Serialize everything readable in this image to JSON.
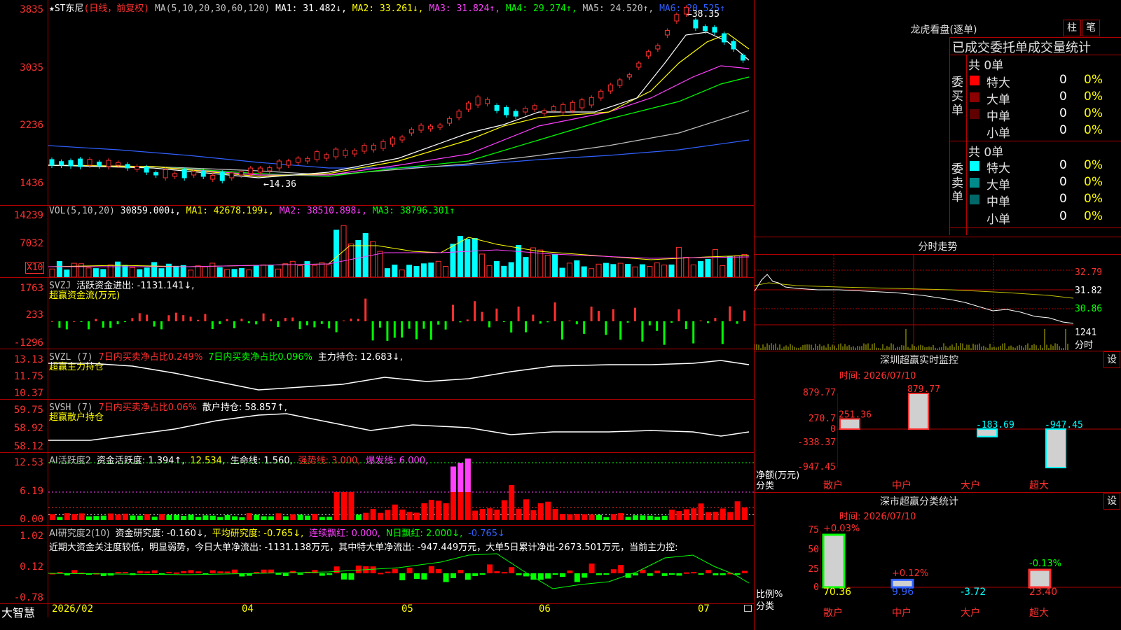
{
  "stock": {
    "name": "★ST东尼",
    "period": "(日线，前复权)"
  },
  "ma_header": {
    "label": "MA(5,10,20,30,60,120)",
    "ma1": "MA1: 31.482↓,",
    "ma2": "MA2: 33.261↓,",
    "ma3": "MA3: 31.824↑,",
    "ma4": "MA4: 29.274↑,",
    "ma5": "MA5: 24.520↑,",
    "ma6": "MA6: 20.525↑",
    "colors": {
      "ma1": "#ffffff",
      "ma2": "#ffff00",
      "ma3": "#ff40ff",
      "ma4": "#00ff00",
      "ma5": "#c0c0c0",
      "ma6": "#3060ff"
    }
  },
  "price_axis": [
    "3835",
    "3035",
    "2236",
    "1436"
  ],
  "price_marks": {
    "high": "←38.35",
    "low": "←14.36"
  },
  "vol": {
    "label": "VOL(5,10,20)",
    "value": "30859.000↓,",
    "ma1": "MA1: 42678.199↓,",
    "ma2": "MA2: 38510.898↓,",
    "ma3": "MA3: 38796.301↑",
    "axis": [
      "14239",
      "7032"
    ],
    "unit": "X10"
  },
  "svzj": {
    "label": "SVZJ",
    "text": "活跃资金进出: -1131.141↓,",
    "sub": "超赢资金流(万元)",
    "axis": [
      "1763",
      "233",
      "-1296"
    ]
  },
  "svzl": {
    "label": "SVZL (7)",
    "t1": "7日内买卖净占比0.249%",
    "t2": "7日内买卖净占比0.096%",
    "t3": "主力持仓: 12.683↓,",
    "sub": "超赢主力持仓",
    "axis": [
      "13.13",
      "11.75",
      "10.37"
    ]
  },
  "svsh": {
    "label": "SVSH (7)",
    "t1": "7日内买卖净占比0.06%",
    "t2": "散户持仓: 58.857↑,",
    "sub": "超赢散户持仓",
    "axis": [
      "59.75",
      "58.92",
      "58.12"
    ]
  },
  "ai1": {
    "label": "AI活跃度2",
    "t1": "资金活跃度: 1.394↑,",
    "t2": "12.534,",
    "t3": "生命线: 1.560,",
    "t4": "强势线: 3.000,",
    "t5": "爆发线: 6.000,",
    "axis": [
      "12.53",
      "6.19",
      "0.00"
    ]
  },
  "ai2": {
    "label": "AI研究度2(10)",
    "t1": "资金研究度: -0.160↓,",
    "t2": "平均研究度: -0.765↓,",
    "t3": "连续飘红: 0.000,",
    "t4": "N日飘红: 2.000↓,",
    "t5": "-0.765↓",
    "desc": "近期大资金关注度较低，明显弱势，今日大单净流出: -1131.138万元，其中特大单净流出: -947.449万元，大单5日累计净出-2673.501万元，当前主力控:",
    "axis": [
      "1.02",
      "0.12",
      "-0.78"
    ]
  },
  "x_axis": [
    "2026/02",
    "04",
    "05",
    "06",
    "07"
  ],
  "app_name": "大智慧",
  "longhu": {
    "title": "龙虎看盘(逐单)",
    "btn1": "柱",
    "btn2": "笔",
    "subtitle": "已成交委托单成交量统计",
    "buy_label": "委买单",
    "sell_label": "委卖单",
    "buy_total": "共 0单",
    "sell_total": "共 0单",
    "buy_rows": [
      {
        "name": "特大",
        "v1": "0",
        "v2": "0%",
        "color": "#ff0000"
      },
      {
        "name": "大单",
        "v1": "0",
        "v2": "0%",
        "color": "#8b0000"
      },
      {
        "name": "中单",
        "v1": "0",
        "v2": "0%",
        "color": "#600000"
      },
      {
        "name": "小单",
        "v1": "0",
        "v2": "0%",
        "color": ""
      }
    ],
    "sell_rows": [
      {
        "name": "特大",
        "v1": "0",
        "v2": "0%",
        "color": "#00ffff"
      },
      {
        "name": "大单",
        "v1": "0",
        "v2": "0%",
        "color": "#008b8b"
      },
      {
        "name": "中单",
        "v1": "0",
        "v2": "0%",
        "color": "#006868"
      },
      {
        "name": "小单",
        "v1": "0",
        "v2": "0%",
        "color": ""
      }
    ]
  },
  "intraday": {
    "title": "分时走势",
    "axis": [
      "32.79",
      "31.82",
      "30.86"
    ],
    "vol_label": "1241",
    "vol_unit": "分时"
  },
  "monitor": {
    "title": "深圳超赢实时监控",
    "btn": "设",
    "time": "时间: 2026/07/10",
    "axis": [
      "879.77",
      "270.7",
      "0",
      "-338.37",
      "-947.45"
    ],
    "unit1": "净额(万元)",
    "unit2": "分类",
    "categories": [
      "散户",
      "中户",
      "大户",
      "超大"
    ],
    "values": [
      251.36,
      879.77,
      -183.69,
      -947.45
    ],
    "labels": [
      "251.36",
      "879.77",
      "-183.69",
      "-947.45"
    ]
  },
  "classify": {
    "title": "深市超赢分类统计",
    "btn": "设",
    "time": "时间: 2026/07/10",
    "axis": [
      "75",
      "50",
      "25",
      "0"
    ],
    "unit1": "比例%",
    "unit2": "分类",
    "categories": [
      "散户",
      "中户",
      "大户",
      "超大"
    ],
    "values": [
      70.36,
      9.96,
      -3.72,
      23.4
    ],
    "bottom": [
      "70.36",
      "9.96",
      "-3.72",
      "23.40"
    ],
    "top": [
      "+0.03%",
      "+0.12%",
      "",
      "-0.13%"
    ]
  }
}
